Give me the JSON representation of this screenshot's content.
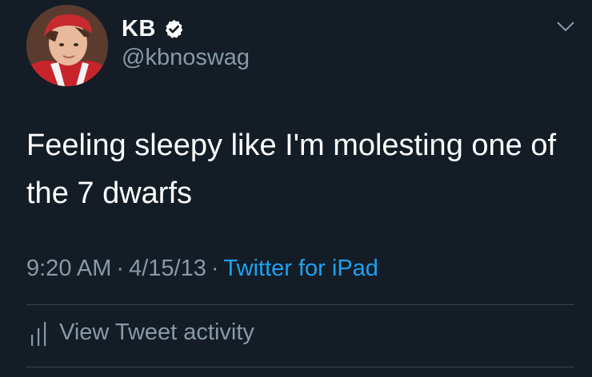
{
  "tweet": {
    "display_name": "KB",
    "verified": true,
    "handle": "@kbnoswag",
    "text": "Feeling sleepy like I'm molesting one of the 7 dwarfs",
    "time": "9:20 AM",
    "separator": "·",
    "date": "4/15/13",
    "source": "Twitter for iPad",
    "activity_label": "View Tweet activity"
  },
  "icons": {
    "verified": "verified-badge-icon",
    "menu": "chevron-down-icon",
    "activity": "bar-chart-icon"
  },
  "colors": {
    "background": "#141d26",
    "text_primary": "#ffffff",
    "text_secondary": "#8899a6",
    "link": "#1da1f2",
    "divider": "#38444d"
  }
}
